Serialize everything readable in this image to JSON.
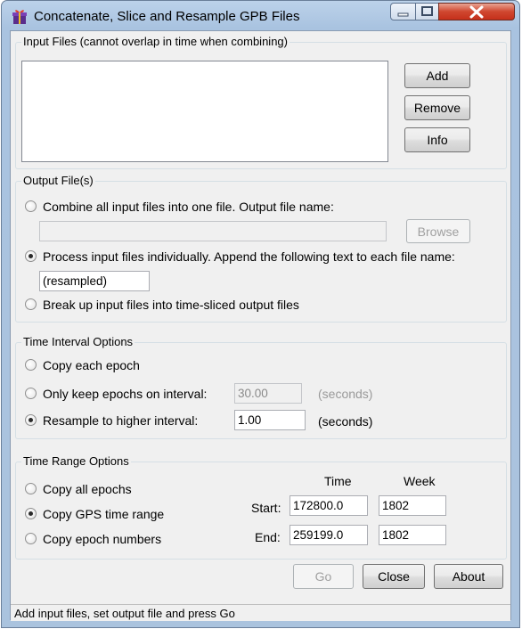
{
  "window": {
    "title": "Concatenate, Slice and Resample GPB Files",
    "icon": "app-gift-box-icon"
  },
  "input_files": {
    "legend": "Input Files (cannot overlap in time when combining)",
    "add_label": "Add",
    "remove_label": "Remove",
    "info_label": "Info"
  },
  "output_files": {
    "legend": "Output File(s)",
    "combine_label": "Combine all input files into one file. Output file name:",
    "combine_filename": "",
    "browse_label": "Browse",
    "individual_label": "Process input files individually. Append the following text to each file name:",
    "append_text": "(resampled)",
    "slice_label": "Break up input files into time-sliced output files",
    "selected": "individual"
  },
  "time_interval": {
    "legend": "Time Interval Options",
    "copy_each_label": "Copy each epoch",
    "only_keep_label": "Only keep epochs on interval:",
    "only_keep_value": "30.00",
    "only_keep_units": "(seconds)",
    "resample_label": "Resample to higher interval:",
    "resample_value": "1.00",
    "resample_units": "(seconds)",
    "selected": "resample"
  },
  "time_range": {
    "legend": "Time Range Options",
    "copy_all_label": "Copy all epochs",
    "copy_gps_label": "Copy GPS time range",
    "copy_epoch_label": "Copy epoch numbers",
    "selected": "gps",
    "time_header": "Time",
    "week_header": "Week",
    "start_label": "Start:",
    "end_label": "End:",
    "start_time": "172800.0",
    "start_week": "1802",
    "end_time": "259199.0",
    "end_week": "1802"
  },
  "actions": {
    "go_label": "Go",
    "close_label": "Close",
    "about_label": "About"
  },
  "status_text": "Add input files, set output file and press Go"
}
